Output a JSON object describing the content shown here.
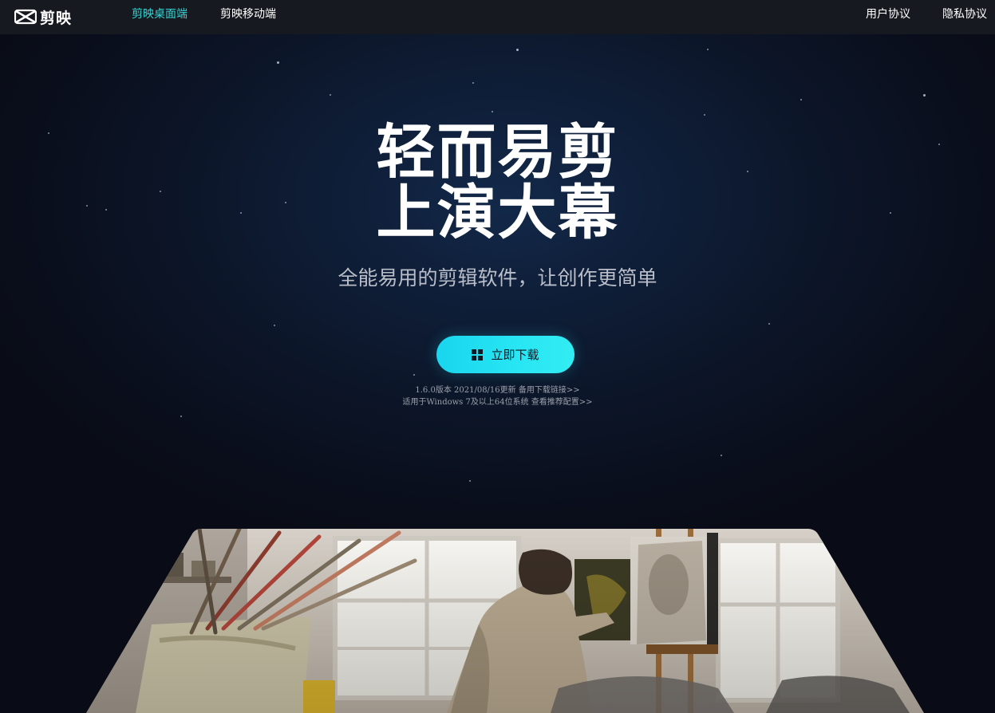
{
  "app": {
    "logo_text": "剪映"
  },
  "nav": {
    "desktop": "剪映桌面端",
    "mobile": "剪映移动端",
    "user_agreement": "用户协议",
    "privacy": "隐私协议"
  },
  "hero": {
    "headline_line1": "轻而易剪",
    "headline_line2": "上演大幕",
    "subtitle": "全能易用的剪辑软件，让创作更简单",
    "download_label": "立即下载",
    "version_info": "1.6.0版本 2021/08/16更新",
    "backup_link": "备用下载链接>>",
    "requirements": "适用于Windows 7及以上64位系统",
    "config_link": "查看推荐配置>>"
  },
  "colors": {
    "accent_active": "#2fd7d7",
    "button": "#28e6f3",
    "topbar": "#16191f"
  },
  "icons": [
    "capcut-logo-icon",
    "windows-icon"
  ]
}
